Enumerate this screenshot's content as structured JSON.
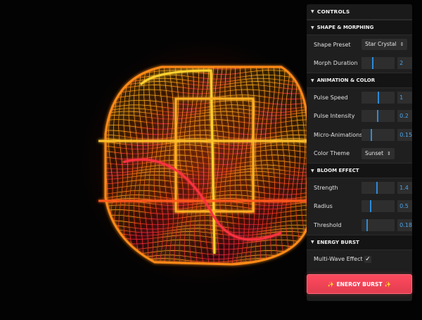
{
  "panel": {
    "title": "CONTROLS",
    "shape_folder": {
      "title": "SHAPE & MORPHING",
      "shape_preset": {
        "label": "Shape Preset",
        "value": "Star Crystal"
      },
      "morph_duration": {
        "label": "Morph Duration",
        "value": "2",
        "level": 0.33
      }
    },
    "animation_folder": {
      "title": "ANIMATION & COLOR",
      "pulse_speed": {
        "label": "Pulse Speed",
        "value": "1",
        "level": 0.5
      },
      "pulse_intensity": {
        "label": "Pulse Intensity",
        "value": "0.2",
        "level": 0.48
      },
      "micro_animations": {
        "label": "Micro-Animations",
        "value": "0.15",
        "level": 0.28
      },
      "color_theme": {
        "label": "Color Theme",
        "value": "Sunset"
      }
    },
    "bloom_folder": {
      "title": "BLOOM EFFECT",
      "strength": {
        "label": "Strength",
        "value": "1.4",
        "level": 0.45
      },
      "radius": {
        "label": "Radius",
        "value": "0.5",
        "level": 0.25
      },
      "threshold": {
        "label": "Threshold",
        "value": "0.18",
        "level": 0.15
      }
    },
    "energy_folder": {
      "title": "ENERGY BURST",
      "multi_wave": {
        "label": "Multi-Wave Effect",
        "checked": true
      }
    },
    "burst_button": {
      "label": "ENERGY BURST",
      "icon": "sparkles-icon"
    }
  },
  "colors": {
    "panel_bg": "#1f1f1f",
    "slider_accent": "#2d8ad9",
    "value_text": "#4ba4e8",
    "button_red": "#e83f52",
    "wire_yellow": "#ffd23a",
    "wire_orange": "#ff7a1a",
    "wire_red": "#ff2b3a"
  }
}
